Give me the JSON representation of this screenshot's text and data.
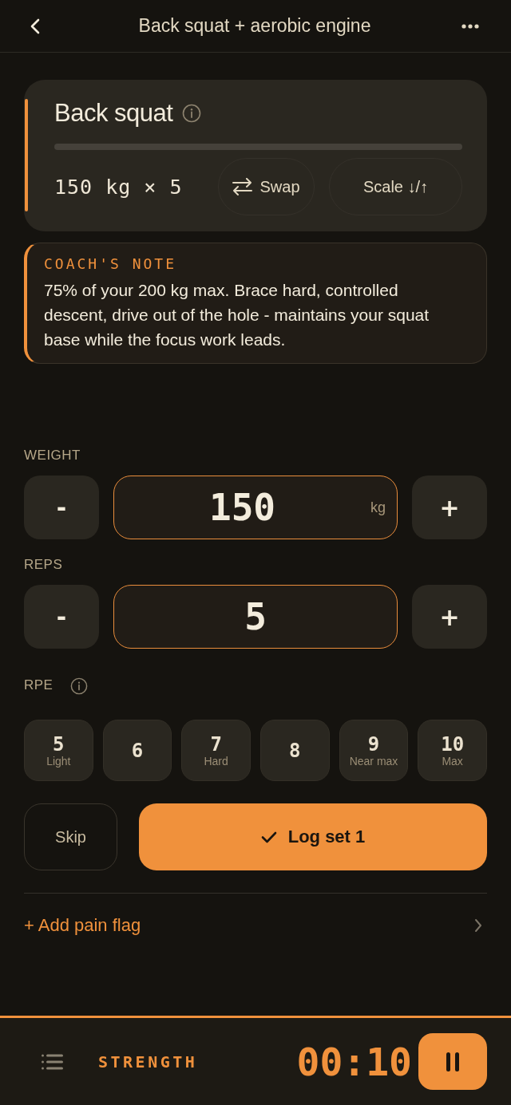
{
  "header": {
    "title": "Back squat + aerobic engine"
  },
  "exercise": {
    "name": "Back squat",
    "prescription": "150 kg × 5",
    "actions": [
      {
        "kind": "swap",
        "label": "Swap"
      },
      {
        "kind": "scale",
        "label": "Scale ↓/↑"
      }
    ]
  },
  "coach_note": {
    "heading": "COACH'S NOTE",
    "text": "75% of your 200 kg max. Brace hard, controlled descent, drive out of the hole - maintains your squat base while the focus work leads."
  },
  "steppers": [
    {
      "label": "WEIGHT",
      "decrement": "-",
      "value": "150",
      "unit": "kg",
      "increment": "+"
    },
    {
      "label": "REPS",
      "decrement": "-",
      "value": "5",
      "increment": "+"
    }
  ],
  "rpe": {
    "label": "RPE",
    "options": [
      {
        "value": "5",
        "caption": "Light",
        "selected": false
      },
      {
        "value": "6",
        "selected": false
      },
      {
        "value": "7",
        "caption": "Hard",
        "selected": false
      },
      {
        "value": "8",
        "selected": false
      },
      {
        "value": "9",
        "caption": "Near max",
        "selected": false
      },
      {
        "value": "10",
        "caption": "Max",
        "selected": false
      }
    ]
  },
  "buttons": {
    "skip": "Skip",
    "log": "Log set 1"
  },
  "pain_flag": {
    "label": "+ Add pain flag"
  },
  "footer": {
    "mode": "STRENGTH",
    "timer": "00:10"
  }
}
